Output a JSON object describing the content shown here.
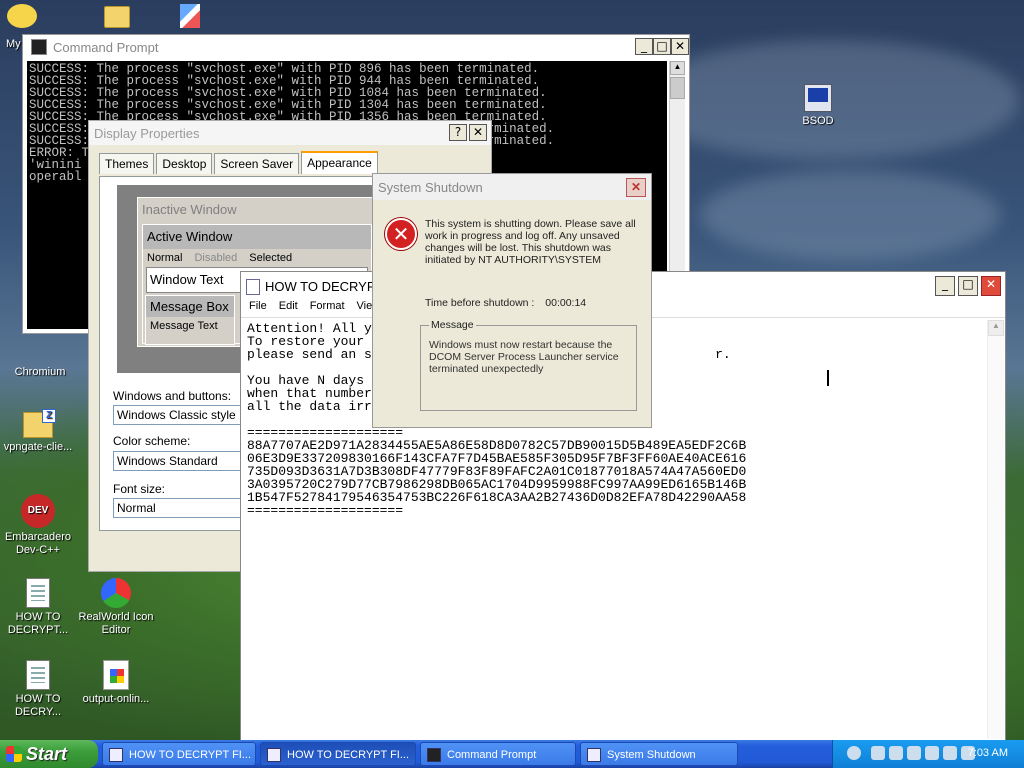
{
  "desktop": {
    "icons": [
      {
        "label": "My",
        "name": "my-computer-icon"
      },
      {
        "label": "Chromium",
        "name": "chromium-icon"
      },
      {
        "label": "vpngate-clie...",
        "name": "vpngate-icon"
      },
      {
        "label": "Embarcadero Dev-C++",
        "name": "devcpp-icon"
      },
      {
        "label": "HOW TO DECRYPT...",
        "name": "decrypt-file-icon"
      },
      {
        "label": "RealWorld Icon Editor",
        "name": "realworld-icon-editor-icon"
      },
      {
        "label": "HOW TO DECRY...",
        "name": "decrypt-file-2-icon"
      },
      {
        "label": "output-onlin...",
        "name": "output-online-icon"
      },
      {
        "label": "BSOD",
        "name": "bsod-icon"
      }
    ]
  },
  "cmd": {
    "title": "Command Prompt",
    "lines": "SUCCESS: The process \"svchost.exe\" with PID 896 has been terminated.\nSUCCESS: The process \"svchost.exe\" with PID 944 has been terminated.\nSUCCESS: The process \"svchost.exe\" with PID 1084 has been terminated.\nSUCCESS: The process \"svchost.exe\" with PID 1304 has been terminated.\nSUCCESS: The process \"svchost.exe\" with PID 1356 has been terminated.\nSUCCESS:                                                   terminated.\nSUCCESS:                                                   terminated.\nERROR: T                                                mmand,\n'winini\noperabl"
  },
  "display_props": {
    "title": "Display Properties",
    "tabs": [
      "Themes",
      "Desktop",
      "Screen Saver",
      "Appearance"
    ],
    "preview": {
      "inactive": "Inactive Window",
      "active": "Active Window",
      "menu_normal": "Normal",
      "menu_disabled": "Disabled",
      "menu_selected": "Selected",
      "window_text": "Window Text",
      "message_box": "Message Box",
      "message_text": "Message Text"
    },
    "windows_buttons_label": "Windows and buttons:",
    "windows_buttons_value": "Windows Classic style",
    "color_scheme_label": "Color scheme:",
    "color_scheme_value": "Windows Standard",
    "font_size_label": "Font size:",
    "font_size_value": "Normal"
  },
  "notepad": {
    "title": "HOW TO DECRYPT",
    "menu": [
      "File",
      "Edit",
      "Format",
      "View"
    ],
    "text": "Attention! All y\nTo restore your\nplease send an s                                            r.\n\nYou have N days\nwhen that number\nall the data irr\n\n====================\n88A7707AE2D971A2834455AE5A86E58D8D0782C57DB90015D5B489EA5EDF2C6B\n06E3D9E337209830166F143CFA7F7D45BAE585F305D95F7BF3FF60AE40ACE616\n735D093D3631A7D3B308DF47779F83F89FAFC2A01C01877018A574A47A560ED0\n3A0395720C279D77CB7986298DB065AC1704D9959988FC997AA99ED6165B146B\n1B547F52784179546354753BC226F618CA3AA2B27436D0D82EFA78D42290AA58\n===================="
  },
  "shutdown": {
    "title": "System Shutdown",
    "message": "This system is shutting down. Please save all work in progress and log off. Any unsaved changes will be lost. This shutdown was initiated by NT AUTHORITY\\SYSTEM",
    "time_label": "Time before shutdown :",
    "time_value": "00:00:14",
    "group_label": "Message",
    "group_message": "Windows must now restart because the DCOM Server Process Launcher service terminated unexpectedly"
  },
  "taskbar": {
    "start": "Start",
    "buttons": [
      "HOW TO DECRYPT FI...",
      "HOW TO DECRYPT FI...",
      "Command Prompt",
      "System Shutdown"
    ],
    "clock": "7:03 AM"
  }
}
